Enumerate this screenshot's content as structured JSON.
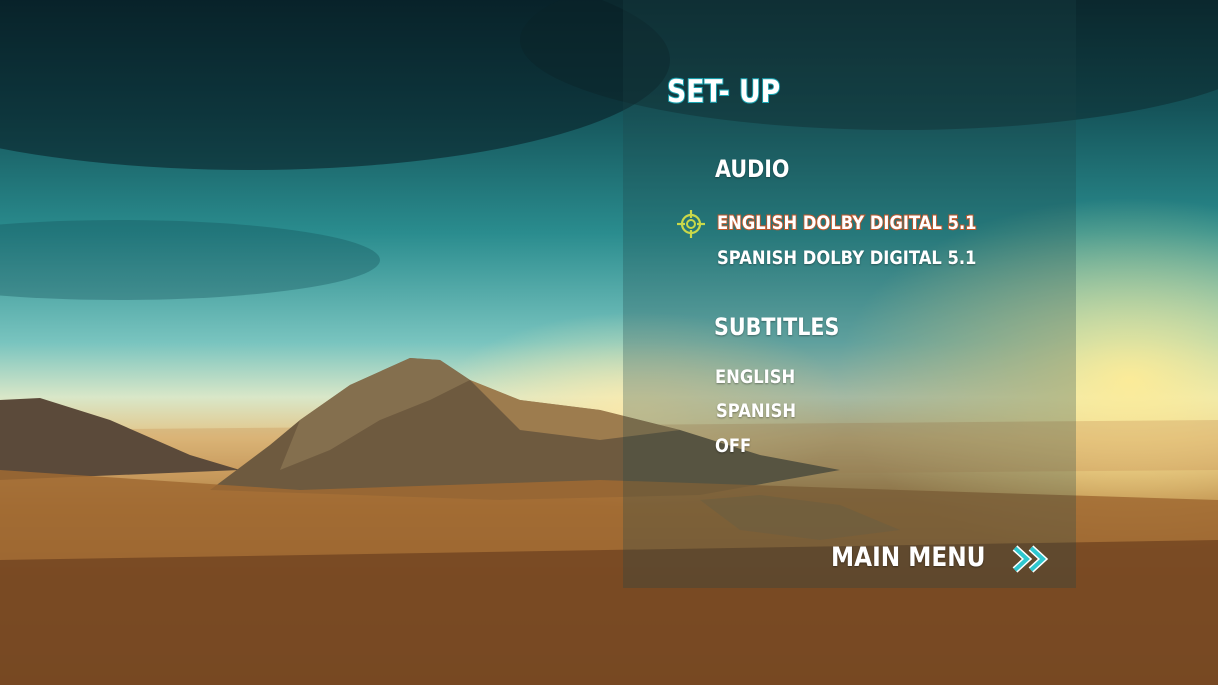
{
  "menu": {
    "title": "SET- UP",
    "audio": {
      "heading": "AUDIO",
      "options": [
        "ENGLISH DOLBY DIGITAL 5.1",
        "SPANISH DOLBY DIGITAL 5.1"
      ],
      "selected": "ENGLISH DOLBY DIGITAL 5.1"
    },
    "subtitles": {
      "heading": "SUBTITLES",
      "options": [
        "ENGLISH",
        "SPANISH",
        "OFF"
      ]
    },
    "main_menu_label": "MAIN MENU"
  },
  "icons": {
    "selection_cursor": "crosshair-icon",
    "forward": "double-chevron-right-icon"
  },
  "colors": {
    "title_outline": "#1fb6c4",
    "selected_outline": "#c8582a",
    "cursor": "#c9d84a",
    "arrow": "#2fc7cf",
    "text": "#ffffff"
  }
}
